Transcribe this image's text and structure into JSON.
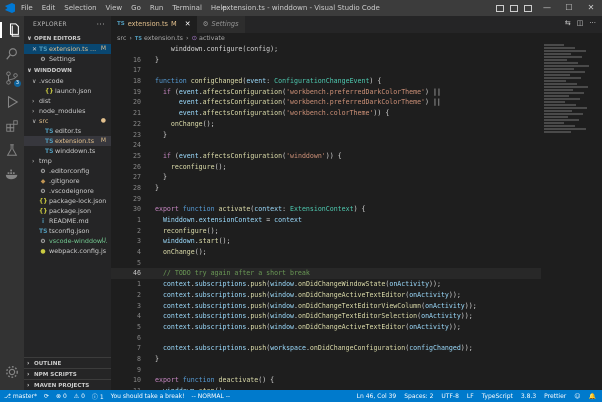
{
  "window": {
    "title": "extension.ts - winddown - Visual Studio Code",
    "menu": [
      "File",
      "Edit",
      "Selection",
      "View",
      "Go",
      "Run",
      "Terminal",
      "Help"
    ],
    "controls": [
      "—",
      "☐",
      "✕"
    ]
  },
  "activity": {
    "scm_badge": "3"
  },
  "sidebar": {
    "title": "EXPLORER",
    "more": "···",
    "open_editors": {
      "label": "OPEN EDITORS",
      "items": [
        {
          "close": "✕",
          "icon": "TS",
          "name": "extension.ts ...",
          "status": "M"
        },
        {
          "icon": "⚙",
          "name": "Settings",
          "status": ""
        }
      ]
    },
    "workspace": {
      "label": "WINDDOWN",
      "items": [
        {
          "indent": 1,
          "chev": "∨",
          "icon": "",
          "name": ".vscode",
          "status": ""
        },
        {
          "indent": 2,
          "chev": "",
          "icon": "{}",
          "name": "launch.json",
          "status": ""
        },
        {
          "indent": 1,
          "chev": "›",
          "icon": "",
          "name": "dist",
          "status": ""
        },
        {
          "indent": 1,
          "chev": "›",
          "icon": "",
          "name": "node_modules",
          "status": ""
        },
        {
          "indent": 1,
          "chev": "∨",
          "icon": "",
          "name": "src",
          "status": "●"
        },
        {
          "indent": 2,
          "chev": "",
          "icon": "TS",
          "name": "editor.ts",
          "status": ""
        },
        {
          "indent": 2,
          "chev": "",
          "icon": "TS",
          "name": "extension.ts",
          "status": "M"
        },
        {
          "indent": 2,
          "chev": "",
          "icon": "TS",
          "name": "winddown.ts",
          "status": ""
        },
        {
          "indent": 1,
          "chev": "›",
          "icon": "",
          "name": "tmp",
          "status": ""
        },
        {
          "indent": 1,
          "chev": "",
          "icon": "⚙",
          "name": ".editorconfig",
          "status": ""
        },
        {
          "indent": 1,
          "chev": "",
          "icon": "◆",
          "name": ".gitignore",
          "status": ""
        },
        {
          "indent": 1,
          "chev": "",
          "icon": "⚙",
          "name": ".vscodeignore",
          "status": ""
        },
        {
          "indent": 1,
          "chev": "",
          "icon": "{}",
          "name": "package-lock.json",
          "status": ""
        },
        {
          "indent": 1,
          "chev": "",
          "icon": "{}",
          "name": "package.json",
          "status": ""
        },
        {
          "indent": 1,
          "chev": "",
          "icon": "i",
          "name": "README.md",
          "status": ""
        },
        {
          "indent": 1,
          "chev": "",
          "icon": "TS",
          "name": "tsconfig.json",
          "status": ""
        },
        {
          "indent": 1,
          "chev": "",
          "icon": "⚙",
          "name": "vscode-winddow...",
          "status": "U"
        },
        {
          "indent": 1,
          "chev": "",
          "icon": "●",
          "name": "webpack.config.js",
          "status": ""
        }
      ]
    },
    "bottom_sections": [
      "OUTLINE",
      "NPM SCRIPTS",
      "MAVEN PROJECTS"
    ]
  },
  "tabs": [
    {
      "icon": "TS",
      "label": "extension.ts",
      "marker": "M",
      "close": "✕",
      "active": true
    },
    {
      "icon": "⚙",
      "label": "Settings",
      "marker": "",
      "close": "",
      "active": false
    }
  ],
  "breadcrumb": {
    "folder": "src",
    "file_icon": "TS",
    "file": "extension.ts",
    "symbol_icon": "⊙",
    "symbol": "activate"
  },
  "code_lines": [
    {
      "n": "",
      "cur": false,
      "toks": [
        [
          "src",
          "    winddown.configure(config);"
        ]
      ]
    },
    {
      "n": "16",
      "cur": false,
      "toks": [
        [
          "src",
          "}"
        ]
      ]
    },
    {
      "n": "17",
      "cur": false,
      "toks": [
        [
          "src",
          ""
        ]
      ]
    },
    {
      "n": "18",
      "cur": false,
      "toks": [
        [
          "kw",
          "function "
        ],
        [
          "fnc",
          "configChanged"
        ],
        [
          "src",
          "("
        ],
        [
          "var",
          "event"
        ],
        [
          "src",
          ": "
        ],
        [
          "typ",
          "ConfigurationChangeEvent"
        ],
        [
          "src",
          ") {"
        ]
      ]
    },
    {
      "n": "19",
      "cur": false,
      "toks": [
        [
          "ctl",
          "  if "
        ],
        [
          "src",
          "("
        ],
        [
          "var",
          "event"
        ],
        [
          "src",
          "."
        ],
        [
          "fnc",
          "affectsConfiguration"
        ],
        [
          "src",
          "("
        ],
        [
          "str",
          "'workbench.preferredDarkColorTheme'"
        ],
        [
          "src",
          ") ||"
        ]
      ]
    },
    {
      "n": "20",
      "cur": false,
      "toks": [
        [
          "src",
          "      "
        ],
        [
          "var",
          "event"
        ],
        [
          "src",
          "."
        ],
        [
          "fnc",
          "affectsConfiguration"
        ],
        [
          "src",
          "("
        ],
        [
          "str",
          "'workbench.preferredDarkColorTheme'"
        ],
        [
          "src",
          ") ||"
        ]
      ]
    },
    {
      "n": "21",
      "cur": false,
      "toks": [
        [
          "src",
          "      "
        ],
        [
          "var",
          "event"
        ],
        [
          "src",
          "."
        ],
        [
          "fnc",
          "affectsConfiguration"
        ],
        [
          "src",
          "("
        ],
        [
          "str",
          "'workbench.colorTheme'"
        ],
        [
          "src",
          ")) {"
        ]
      ]
    },
    {
      "n": "22",
      "cur": false,
      "toks": [
        [
          "src",
          "    "
        ],
        [
          "fnc",
          "onChange"
        ],
        [
          "src",
          "();"
        ]
      ]
    },
    {
      "n": "23",
      "cur": false,
      "toks": [
        [
          "src",
          "  }"
        ]
      ]
    },
    {
      "n": "24",
      "cur": false,
      "toks": [
        [
          "src",
          ""
        ]
      ]
    },
    {
      "n": "25",
      "cur": false,
      "toks": [
        [
          "ctl",
          "  if "
        ],
        [
          "src",
          "("
        ],
        [
          "var",
          "event"
        ],
        [
          "src",
          "."
        ],
        [
          "fnc",
          "affectsConfiguration"
        ],
        [
          "src",
          "("
        ],
        [
          "str",
          "'winddown'"
        ],
        [
          "src",
          ")) {"
        ]
      ]
    },
    {
      "n": "26",
      "cur": false,
      "toks": [
        [
          "src",
          "    "
        ],
        [
          "fnc",
          "reconfigure"
        ],
        [
          "src",
          "();"
        ]
      ]
    },
    {
      "n": "27",
      "cur": false,
      "toks": [
        [
          "src",
          "  }"
        ]
      ]
    },
    {
      "n": "28",
      "cur": false,
      "toks": [
        [
          "src",
          "}"
        ]
      ]
    },
    {
      "n": "29",
      "cur": false,
      "toks": [
        [
          "src",
          ""
        ]
      ]
    },
    {
      "n": "30",
      "cur": false,
      "toks": [
        [
          "ctl",
          "export "
        ],
        [
          "kw",
          "function "
        ],
        [
          "fnc",
          "activate"
        ],
        [
          "src",
          "("
        ],
        [
          "var",
          "context"
        ],
        [
          "src",
          ": "
        ],
        [
          "typ",
          "ExtensionContext"
        ],
        [
          "src",
          ") {"
        ]
      ]
    },
    {
      "n": "1",
      "cur": false,
      "toks": [
        [
          "src",
          "  "
        ],
        [
          "var",
          "Winddown"
        ],
        [
          "src",
          "."
        ],
        [
          "var",
          "extensionContext"
        ],
        [
          "src",
          " = "
        ],
        [
          "var",
          "context"
        ]
      ]
    },
    {
      "n": "2",
      "cur": false,
      "toks": [
        [
          "src",
          "  "
        ],
        [
          "fnc",
          "reconfigure"
        ],
        [
          "src",
          "();"
        ]
      ]
    },
    {
      "n": "3",
      "cur": false,
      "toks": [
        [
          "src",
          "  "
        ],
        [
          "var",
          "winddown"
        ],
        [
          "src",
          "."
        ],
        [
          "fnc",
          "start"
        ],
        [
          "src",
          "();"
        ]
      ]
    },
    {
      "n": "4",
      "cur": false,
      "toks": [
        [
          "src",
          "  "
        ],
        [
          "fnc",
          "onChange"
        ],
        [
          "src",
          "();"
        ]
      ]
    },
    {
      "n": "5",
      "cur": false,
      "toks": [
        [
          "src",
          ""
        ]
      ]
    },
    {
      "n": "46",
      "cur": true,
      "toks": [
        [
          "cmt",
          "  // TODO try again after a short break"
        ]
      ]
    },
    {
      "n": "1",
      "cur": false,
      "toks": [
        [
          "src",
          "  "
        ],
        [
          "var",
          "context"
        ],
        [
          "src",
          "."
        ],
        [
          "var",
          "subscriptions"
        ],
        [
          "src",
          "."
        ],
        [
          "fnc",
          "push"
        ],
        [
          "src",
          "("
        ],
        [
          "var",
          "window"
        ],
        [
          "src",
          "."
        ],
        [
          "fnc",
          "onDidChangeWindowState"
        ],
        [
          "src",
          "("
        ],
        [
          "var",
          "onActivity"
        ],
        [
          "src",
          "));"
        ]
      ]
    },
    {
      "n": "2",
      "cur": false,
      "toks": [
        [
          "src",
          "  "
        ],
        [
          "var",
          "context"
        ],
        [
          "src",
          "."
        ],
        [
          "var",
          "subscriptions"
        ],
        [
          "src",
          "."
        ],
        [
          "fnc",
          "push"
        ],
        [
          "src",
          "("
        ],
        [
          "var",
          "window"
        ],
        [
          "src",
          "."
        ],
        [
          "fnc",
          "onDidChangeActiveTextEditor"
        ],
        [
          "src",
          "("
        ],
        [
          "var",
          "onActivity"
        ],
        [
          "src",
          "));"
        ]
      ]
    },
    {
      "n": "3",
      "cur": false,
      "toks": [
        [
          "src",
          "  "
        ],
        [
          "var",
          "context"
        ],
        [
          "src",
          "."
        ],
        [
          "var",
          "subscriptions"
        ],
        [
          "src",
          "."
        ],
        [
          "fnc",
          "push"
        ],
        [
          "src",
          "("
        ],
        [
          "var",
          "window"
        ],
        [
          "src",
          "."
        ],
        [
          "fnc",
          "onDidChangeTextEditorViewColumn"
        ],
        [
          "src",
          "("
        ],
        [
          "var",
          "onActivity"
        ],
        [
          "src",
          "));"
        ]
      ]
    },
    {
      "n": "4",
      "cur": false,
      "toks": [
        [
          "src",
          "  "
        ],
        [
          "var",
          "context"
        ],
        [
          "src",
          "."
        ],
        [
          "var",
          "subscriptions"
        ],
        [
          "src",
          "."
        ],
        [
          "fnc",
          "push"
        ],
        [
          "src",
          "("
        ],
        [
          "var",
          "window"
        ],
        [
          "src",
          "."
        ],
        [
          "fnc",
          "onDidChangeTextEditorSelection"
        ],
        [
          "src",
          "("
        ],
        [
          "var",
          "onActivity"
        ],
        [
          "src",
          "));"
        ]
      ]
    },
    {
      "n": "5",
      "cur": false,
      "toks": [
        [
          "src",
          "  "
        ],
        [
          "var",
          "context"
        ],
        [
          "src",
          "."
        ],
        [
          "var",
          "subscriptions"
        ],
        [
          "src",
          "."
        ],
        [
          "fnc",
          "push"
        ],
        [
          "src",
          "("
        ],
        [
          "var",
          "window"
        ],
        [
          "src",
          "."
        ],
        [
          "fnc",
          "onDidChangeActiveTextEditor"
        ],
        [
          "src",
          "("
        ],
        [
          "var",
          "onActivity"
        ],
        [
          "src",
          "));"
        ]
      ]
    },
    {
      "n": "6",
      "cur": false,
      "toks": [
        [
          "src",
          ""
        ]
      ]
    },
    {
      "n": "7",
      "cur": false,
      "toks": [
        [
          "src",
          "  "
        ],
        [
          "var",
          "context"
        ],
        [
          "src",
          "."
        ],
        [
          "var",
          "subscriptions"
        ],
        [
          "src",
          "."
        ],
        [
          "fnc",
          "push"
        ],
        [
          "src",
          "("
        ],
        [
          "var",
          "workspace"
        ],
        [
          "src",
          "."
        ],
        [
          "fnc",
          "onDidChangeConfiguration"
        ],
        [
          "src",
          "("
        ],
        [
          "var",
          "configChanged"
        ],
        [
          "src",
          "));"
        ]
      ]
    },
    {
      "n": "8",
      "cur": false,
      "toks": [
        [
          "src",
          "}"
        ]
      ]
    },
    {
      "n": "9",
      "cur": false,
      "toks": [
        [
          "src",
          ""
        ]
      ]
    },
    {
      "n": "10",
      "cur": false,
      "toks": [
        [
          "ctl",
          "export "
        ],
        [
          "kw",
          "function "
        ],
        [
          "fnc",
          "deactivate"
        ],
        [
          "src",
          "() {"
        ]
      ]
    },
    {
      "n": "11",
      "cur": false,
      "toks": [
        [
          "src",
          "  "
        ],
        [
          "var",
          "winddown"
        ],
        [
          "src",
          "."
        ],
        [
          "fnc",
          "stop"
        ],
        [
          "src",
          "();"
        ]
      ]
    },
    {
      "n": "12",
      "cur": false,
      "toks": [
        [
          "src",
          "}"
        ]
      ]
    },
    {
      "n": "13",
      "cur": false,
      "toks": [
        [
          "src",
          ""
        ]
      ]
    }
  ],
  "statusbar": {
    "branch": "master*",
    "sync": "⟳",
    "errors": "⊗ 0",
    "warnings": "⚠ 0",
    "info": "ⓘ 1",
    "message": "You should take a break!",
    "vim_mode": "-- NORMAL --",
    "position": "Ln 46, Col 39",
    "spaces": "Spaces: 2",
    "encoding": "UTF-8",
    "eol": "LF",
    "language": "TypeScript",
    "ts_version": "3.8.3",
    "formatter": "Prettier",
    "feedback": "☺",
    "bell": "🔔"
  },
  "colors": {
    "statusbar": "#007acc",
    "activitybar": "#333333",
    "sidebar": "#252526",
    "editor": "#1e1e1e"
  }
}
